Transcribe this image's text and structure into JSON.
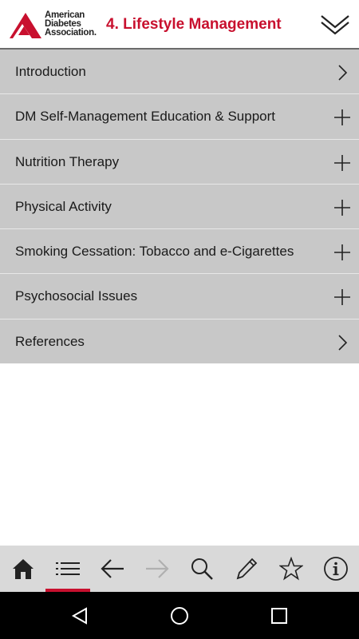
{
  "header": {
    "logo_lines": [
      "American",
      "Diabetes",
      "Association."
    ],
    "title": "4. Lifestyle Management"
  },
  "sections": [
    {
      "label": "Introduction",
      "icon": "chevron-right-icon"
    },
    {
      "label": "DM Self-Management Education & Support",
      "icon": "plus-icon"
    },
    {
      "label": "Nutrition Therapy",
      "icon": "plus-icon"
    },
    {
      "label": "Physical Activity",
      "icon": "plus-icon"
    },
    {
      "label": "Smoking Cessation: Tobacco and e-Cigarettes",
      "icon": "plus-icon"
    },
    {
      "label": "Psychosocial Issues",
      "icon": "plus-icon"
    },
    {
      "label": "References",
      "icon": "chevron-right-icon"
    }
  ],
  "toolbar": {
    "items": [
      "home-icon",
      "list-icon",
      "back-arrow-icon",
      "forward-arrow-icon",
      "search-icon",
      "pencil-icon",
      "star-icon",
      "info-icon"
    ],
    "active_item": "list-icon",
    "disabled_item": "forward-arrow-icon"
  },
  "android_nav": [
    "back-triangle-icon",
    "home-circle-icon",
    "recents-square-icon"
  ],
  "colors": {
    "brand_red": "#c8102e",
    "row_background": "#c8c8c8",
    "toolbar_background": "#d9d9d9"
  }
}
